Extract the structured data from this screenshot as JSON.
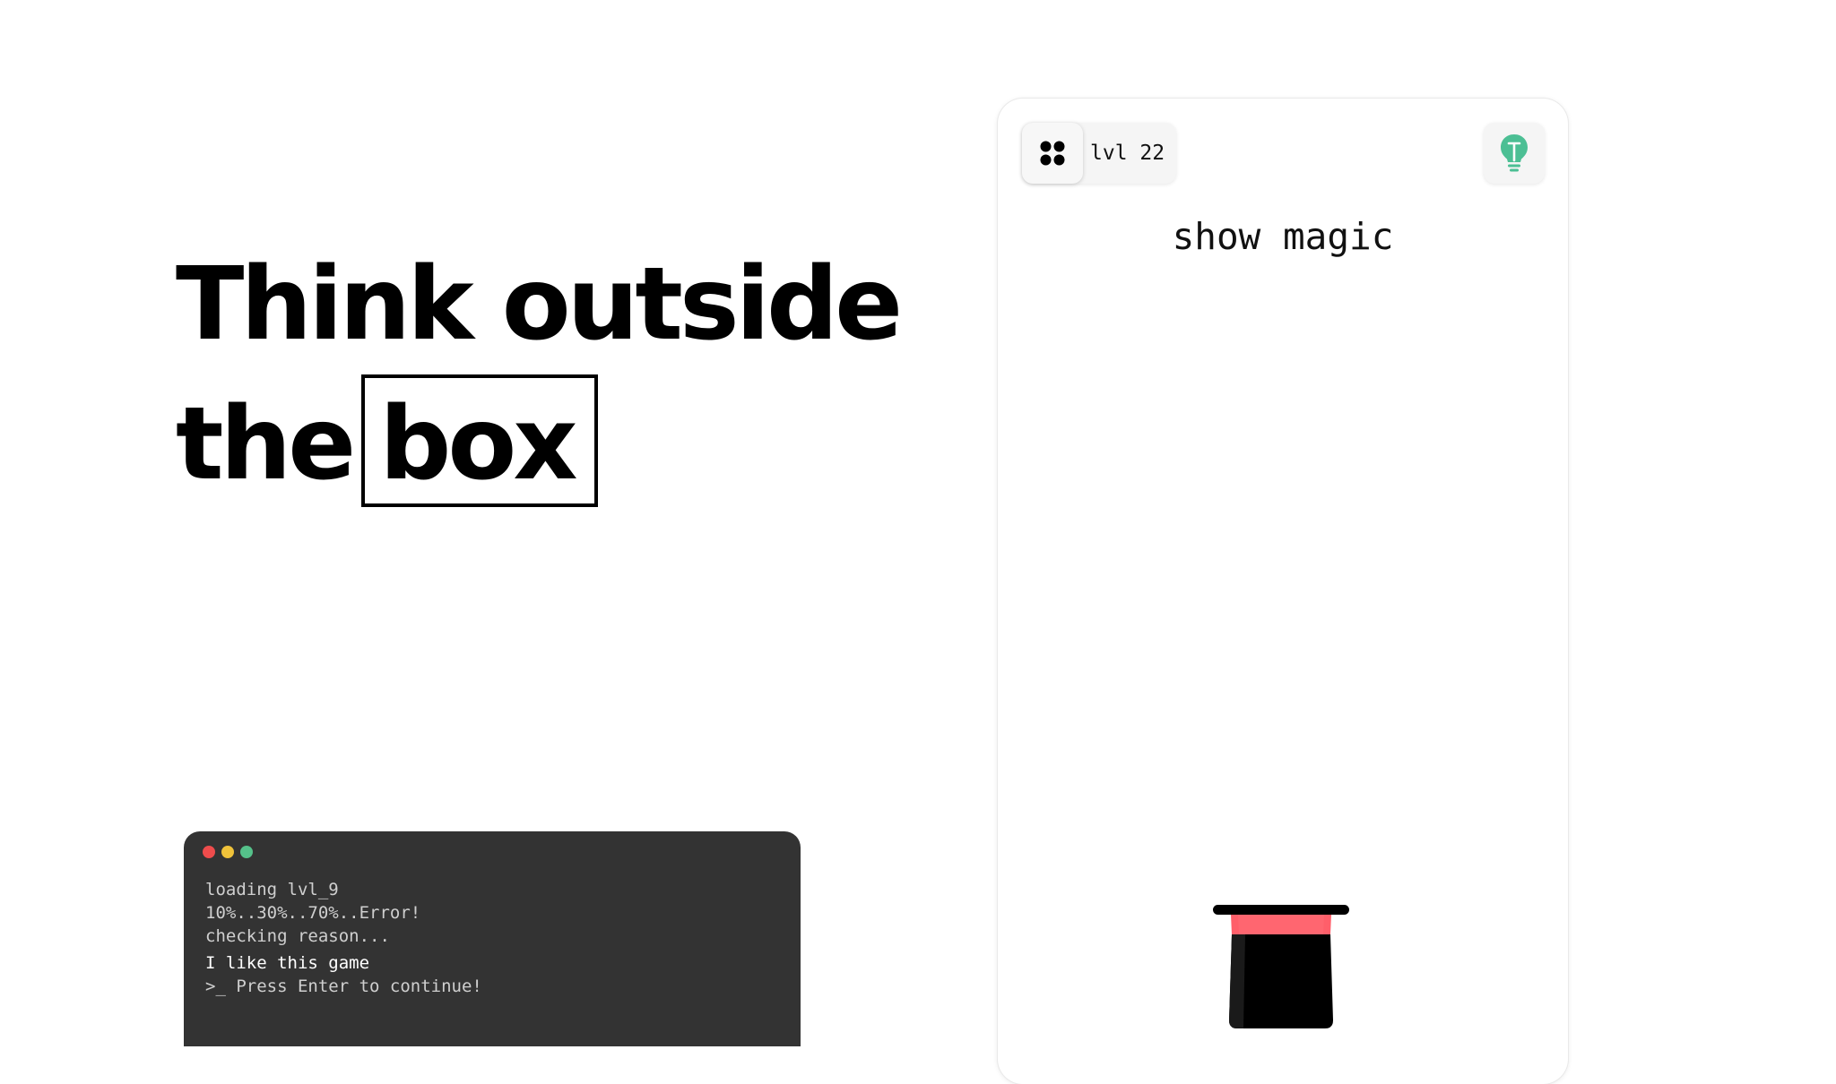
{
  "headline": {
    "line1": "Think outside",
    "line2_prefix": "the",
    "line2_boxed": "box"
  },
  "terminal": {
    "window_dots": [
      "#ee4c4c",
      "#efc23a",
      "#55c18a"
    ],
    "lines": [
      "loading lvl_9",
      "10%..30%..70%..Error!",
      "checking reason...",
      "I like this game",
      ">_ Press Enter to continue!"
    ]
  },
  "game": {
    "level_label": "lvl 22",
    "menu_icon": "four-dots-grid-icon",
    "hint_icon": "lightbulb-icon",
    "hint_color": "#4cbf94",
    "prompt": "show magic",
    "object": "magic-top-hat",
    "hat_band_color": "#ff5f6a"
  }
}
